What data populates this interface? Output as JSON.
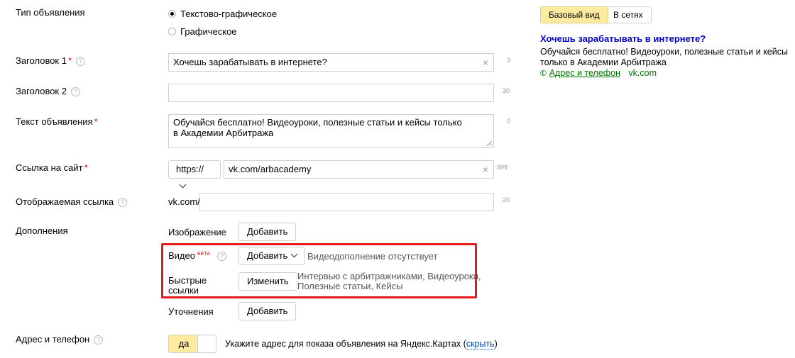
{
  "labels": {
    "ad_type": "Тип объявления",
    "title1": "Заголовок 1",
    "title2": "Заголовок 2",
    "ad_text": "Текст объявления",
    "site_link": "Ссылка на сайт",
    "display_link": "Отображаемая ссылка",
    "extras": "Дополнения",
    "address_phone": "Адрес и телефон",
    "required_mark": "*",
    "help_mark": "?"
  },
  "ad_type": {
    "options": [
      "Текстово-графическое",
      "Графическое"
    ],
    "selected": "Текстово-графическое"
  },
  "title1": {
    "value": "Хочешь зарабатывать в интернете?",
    "counter": "3",
    "clear": "×"
  },
  "title2": {
    "value": "",
    "counter": "30"
  },
  "ad_text": {
    "line1": "Обучайся бесплатно! Видеоуроки, полезные статьи и кейсы только",
    "line2": "в Академии Арбитража",
    "counter": "0"
  },
  "site_link": {
    "protocol": "https://",
    "value": "vk.com/arbacademy",
    "counter": "999",
    "clear": "×"
  },
  "display_link": {
    "prefix": "vk.com/",
    "value": "",
    "counter": "20"
  },
  "extras": {
    "image": {
      "label": "Изображение",
      "button": "Добавить"
    },
    "video": {
      "label": "Видео",
      "badge": "БЕТА",
      "button": "Добавить",
      "status": "Видеодополнение отсутствует"
    },
    "quick_links": {
      "label_line1": "Быстрые",
      "label_line2": "ссылки",
      "button": "Изменить",
      "value_line1": "Интервью с арбитражниками, Видеоуроки,",
      "value_line2": "Полезные статьи, Кейсы"
    },
    "clarifications": {
      "label": "Уточнения",
      "button": "Добавить"
    }
  },
  "address": {
    "toggle_label": "да",
    "hint": "Укажите адрес для показа объявления на Яндекс.Картах (",
    "hide_link": "скрыть",
    "hint_end": ")"
  },
  "preview": {
    "tabs": [
      "Базовый вид",
      "В сетях"
    ],
    "active_tab": "Базовый вид",
    "title": "Хочешь зарабатывать в интернете?",
    "text_line1": "Обучайся бесплатно! Видеоуроки, полезные статьи и кейсы",
    "text_line2": "только в Академии Арбитража",
    "address_link": "Адрес и телефон",
    "domain": "vk.com"
  },
  "colors": {
    "highlight_border": "#e31b1b",
    "active_yellow": "#ffeba0",
    "link_blue": "#0044bb",
    "required_red": "#ee0000"
  }
}
